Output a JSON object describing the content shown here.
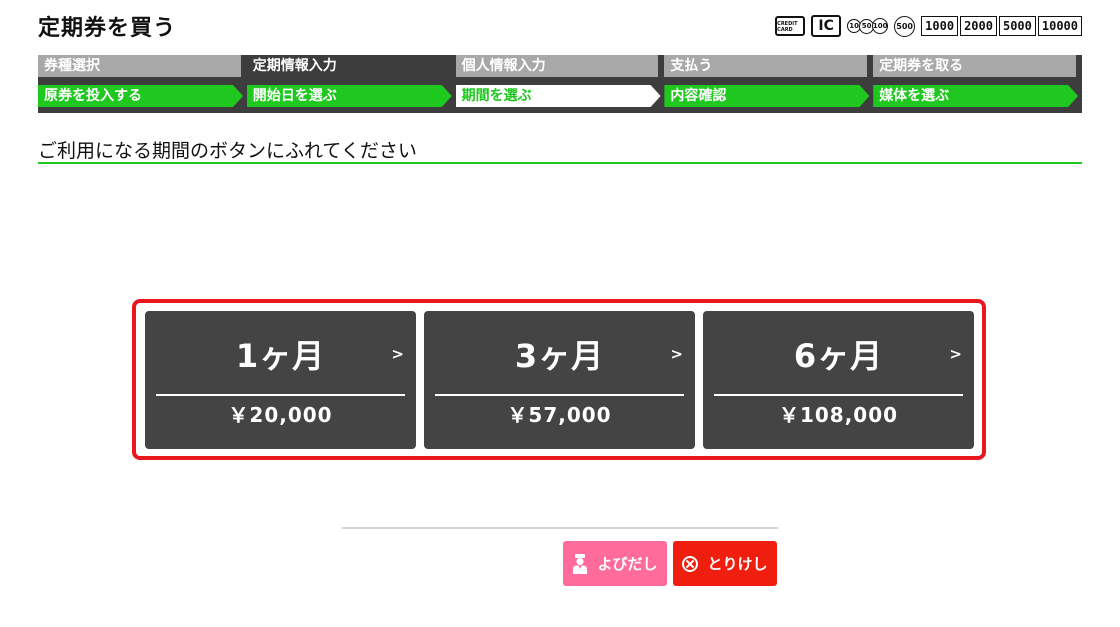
{
  "header": {
    "title": "定期券を買う",
    "payment": {
      "card_label": "CREDIT CARD",
      "ic_label": "IC",
      "coins": [
        "10",
        "50",
        "100",
        "500"
      ],
      "bills": [
        "1000",
        "2000",
        "5000",
        "10000"
      ]
    }
  },
  "steps": [
    {
      "top": "券種選択",
      "bottom": "原券を投入する"
    },
    {
      "top": "定期情報入力",
      "bottom": "開始日を選ぶ"
    },
    {
      "top": "個人情報入力",
      "bottom": "期間を選ぶ"
    },
    {
      "top": "支払う",
      "bottom": "内容確認"
    },
    {
      "top": "定期券を取る",
      "bottom": "媒体を選ぶ"
    }
  ],
  "instruction": "ご利用になる期間のボタンにふれてください",
  "options": [
    {
      "period": "1ヶ月",
      "price": "￥20,000",
      "chevron": ">"
    },
    {
      "period": "3ヶ月",
      "price": "￥57,000",
      "chevron": ">"
    },
    {
      "period": "6ヶ月",
      "price": "￥108,000",
      "chevron": ">"
    }
  ],
  "buttons": {
    "call": "よびだし",
    "cancel": "とりけし"
  },
  "colors": {
    "accent_green": "#1ec81e",
    "highlight_red": "#e8181e",
    "call_pink": "#ff6b9b",
    "cancel_red": "#f01e0e"
  }
}
